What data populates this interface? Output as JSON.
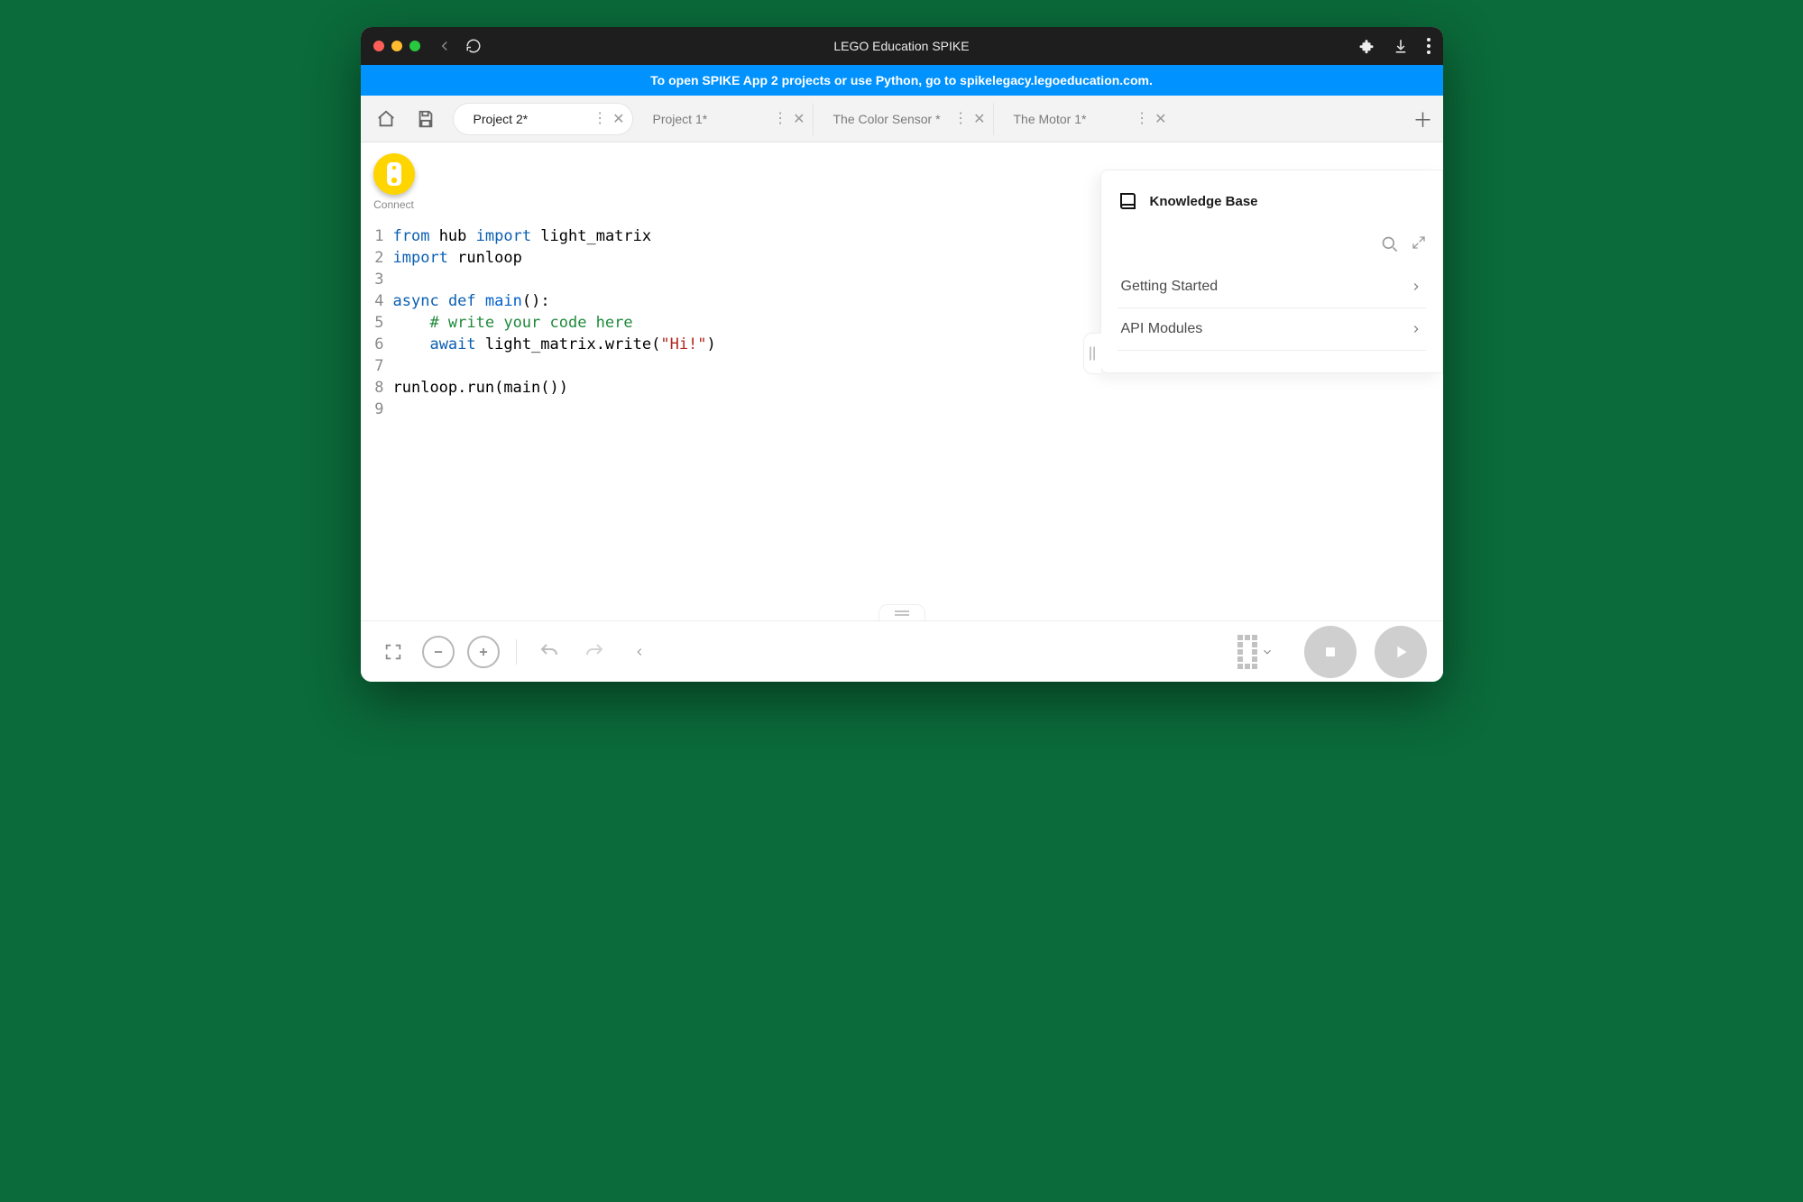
{
  "titlebar": {
    "title": "LEGO Education SPIKE"
  },
  "banner": {
    "text": "To open SPIKE App 2 projects or use Python, go to spikelegacy.legoeducation.com."
  },
  "tabs": [
    {
      "label": "Project 2*",
      "active": true
    },
    {
      "label": "Project 1*",
      "active": false
    },
    {
      "label": "The Color Sensor *",
      "active": false
    },
    {
      "label": "The Motor 1*",
      "active": false
    }
  ],
  "connect": {
    "label": "Connect"
  },
  "code_lines": [
    {
      "n": "1",
      "html": "<span class='kw'>from</span> hub <span class='kw'>import</span> light_matrix"
    },
    {
      "n": "2",
      "html": "<span class='kw'>import</span> runloop"
    },
    {
      "n": "3",
      "html": ""
    },
    {
      "n": "4",
      "html": "<span class='kw'>async</span> <span class='kw'>def</span> <span class='fn'>main</span>():"
    },
    {
      "n": "5",
      "html": "    <span class='cm'># write your code here</span>"
    },
    {
      "n": "6",
      "html": "    <span class='kw'>await</span> light_matrix.write(<span class='st'>\"Hi!\"</span>)"
    },
    {
      "n": "7",
      "html": ""
    },
    {
      "n": "8",
      "html": "runloop.run(main())"
    },
    {
      "n": "9",
      "html": ""
    }
  ],
  "kb": {
    "title": "Knowledge Base",
    "items": [
      "Getting Started",
      "API Modules"
    ]
  }
}
